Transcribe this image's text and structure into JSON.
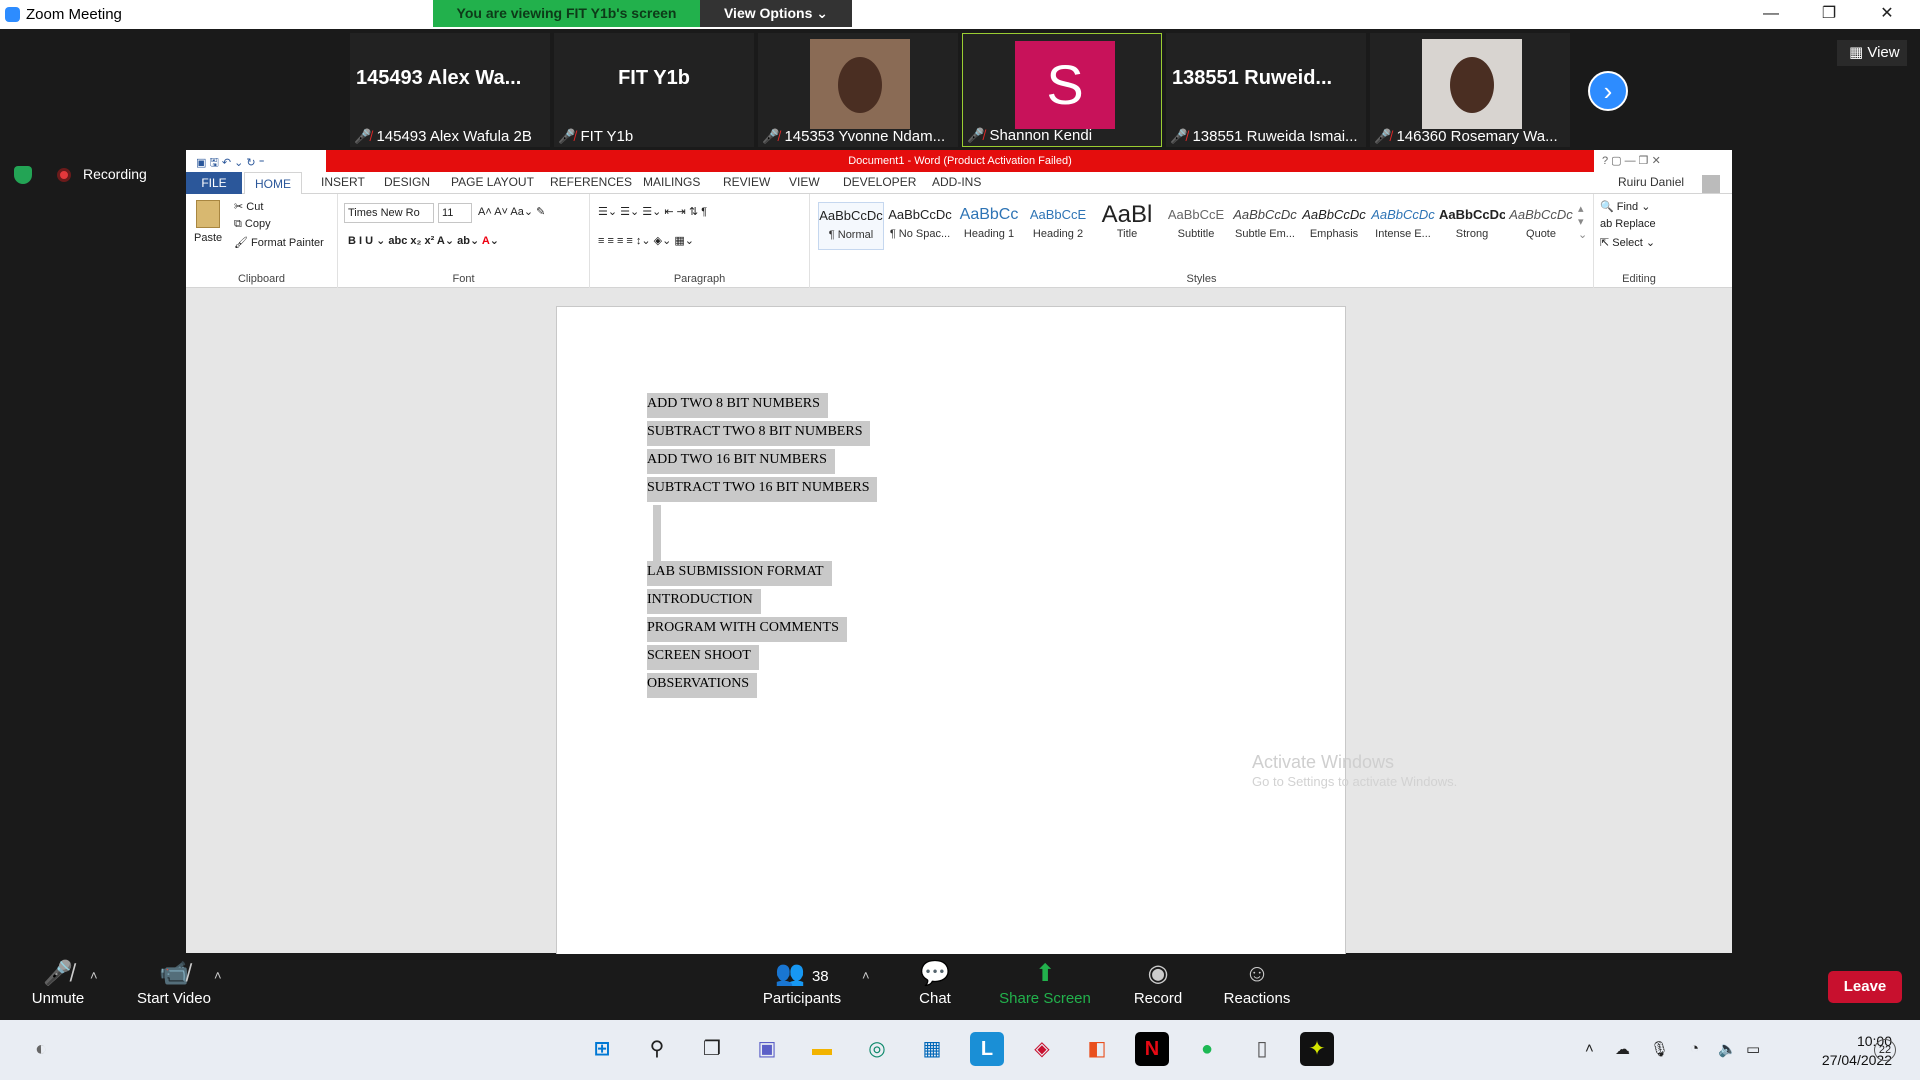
{
  "window": {
    "title": "Zoom Meeting",
    "minimize": "—",
    "restore": "❐",
    "close": "✕"
  },
  "banner": {
    "viewing": "You are viewing FIT Y1b's screen",
    "view_options": "View Options ⌄"
  },
  "participants_strip": [
    {
      "big": "145493  Alex  Wa...",
      "label": "145493 Alex Wafula 2B",
      "kind": "name"
    },
    {
      "big": "FIT Y1b",
      "label": "FIT Y1b",
      "kind": "name"
    },
    {
      "big": "",
      "label": "145353 Yvonne Ndam...",
      "kind": "photo"
    },
    {
      "big": "S",
      "label": "Shannon Kendi",
      "kind": "initial"
    },
    {
      "big": "138551  Ruweid...",
      "label": "138551 Ruweida Ismai...",
      "kind": "name"
    },
    {
      "big": "",
      "label": "146360 Rosemary Wa...",
      "kind": "photo"
    }
  ],
  "view_button": "View",
  "recording": "Recording",
  "word": {
    "title": "Document1 - Word (Product Activation Failed)",
    "user": "Ruiru Daniel",
    "tabs": [
      "FILE",
      "HOME",
      "INSERT",
      "DESIGN",
      "PAGE LAYOUT",
      "REFERENCES",
      "MAILINGS",
      "REVIEW",
      "VIEW",
      "DEVELOPER",
      "ADD-INS"
    ],
    "clipboard": {
      "paste": "Paste",
      "cut": "Cut",
      "copy": "Copy",
      "format_painter": "Format Painter",
      "label": "Clipboard"
    },
    "font": {
      "name": "Times New Ro",
      "size": "11",
      "label": "Font"
    },
    "paragraph_label": "Paragraph",
    "styles": [
      {
        "preview": "AaBbCcDc",
        "name": "¶ Normal"
      },
      {
        "preview": "AaBbCcDc",
        "name": "¶ No Spac..."
      },
      {
        "preview": "AaBbCc",
        "name": "Heading 1"
      },
      {
        "preview": "AaBbCcE",
        "name": "Heading 2"
      },
      {
        "preview": "AaBl",
        "name": "Title"
      },
      {
        "preview": "AaBbCcE",
        "name": "Subtitle"
      },
      {
        "preview": "AaBbCcDc",
        "name": "Subtle Em..."
      },
      {
        "preview": "AaBbCcDc",
        "name": "Emphasis"
      },
      {
        "preview": "AaBbCcDc",
        "name": "Intense E..."
      },
      {
        "preview": "AaBbCcDc",
        "name": "Strong"
      },
      {
        "preview": "AaBbCcDc",
        "name": "Quote"
      }
    ],
    "styles_label": "Styles",
    "editing": {
      "find": "Find",
      "replace": "Replace",
      "select": "Select",
      "label": "Editing"
    },
    "doc_lines": [
      "ADD TWO 8 BIT NUMBERS",
      "SUBTRACT TWO 8 BIT NUMBERS",
      "ADD TWO 16 BIT NUMBERS",
      "SUBTRACT TWO 16 BIT NUMBERS",
      "",
      "LAB SUBMISSION FORMAT",
      "INTRODUCTION",
      "PROGRAM WITH COMMENTS",
      "SCREEN SHOOT",
      "OBSERVATIONS"
    ]
  },
  "watermark": {
    "line1": "Activate Windows",
    "line2": "Go to Settings to activate Windows."
  },
  "controls": {
    "unmute": "Unmute",
    "start_video": "Start Video",
    "participants": "Participants",
    "participants_count": "38",
    "chat": "Chat",
    "share_screen": "Share Screen",
    "record": "Record",
    "reactions": "Reactions",
    "leave": "Leave"
  },
  "taskbar": {
    "time": "10:00",
    "date": "27/04/2022",
    "notifications": "22"
  }
}
